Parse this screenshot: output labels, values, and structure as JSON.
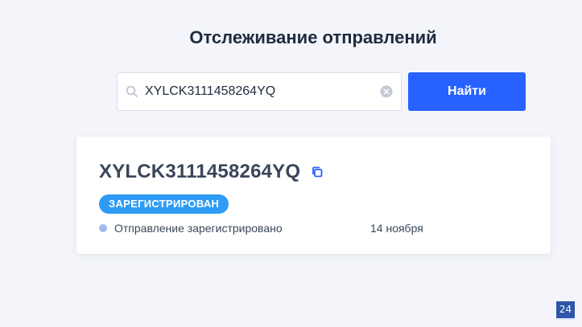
{
  "page": {
    "title": "Отслеживание отправлений"
  },
  "search": {
    "value": "XYLCK3111458264YQ",
    "placeholder": "",
    "button_label": "Найти",
    "search_icon": "search-icon",
    "clear_icon": "close-circle-icon"
  },
  "result": {
    "track_number": "XYLCK3111458264YQ",
    "copy_icon": "copy-icon",
    "status": "ЗАРЕГИСТРИРОВАН",
    "events": [
      {
        "text": "Отправление зарегистрировано",
        "date": "14 ноября"
      }
    ]
  },
  "corner_logo": {
    "text": "24"
  },
  "colors": {
    "background": "#f3f5fa",
    "primary": "#2761ff",
    "status_badge": "#2e9cf5",
    "event_dot": "#a3b8ee",
    "text_dark": "#1f2b3d",
    "text_body": "#3a4658",
    "logo_bg": "#2e56a8"
  }
}
